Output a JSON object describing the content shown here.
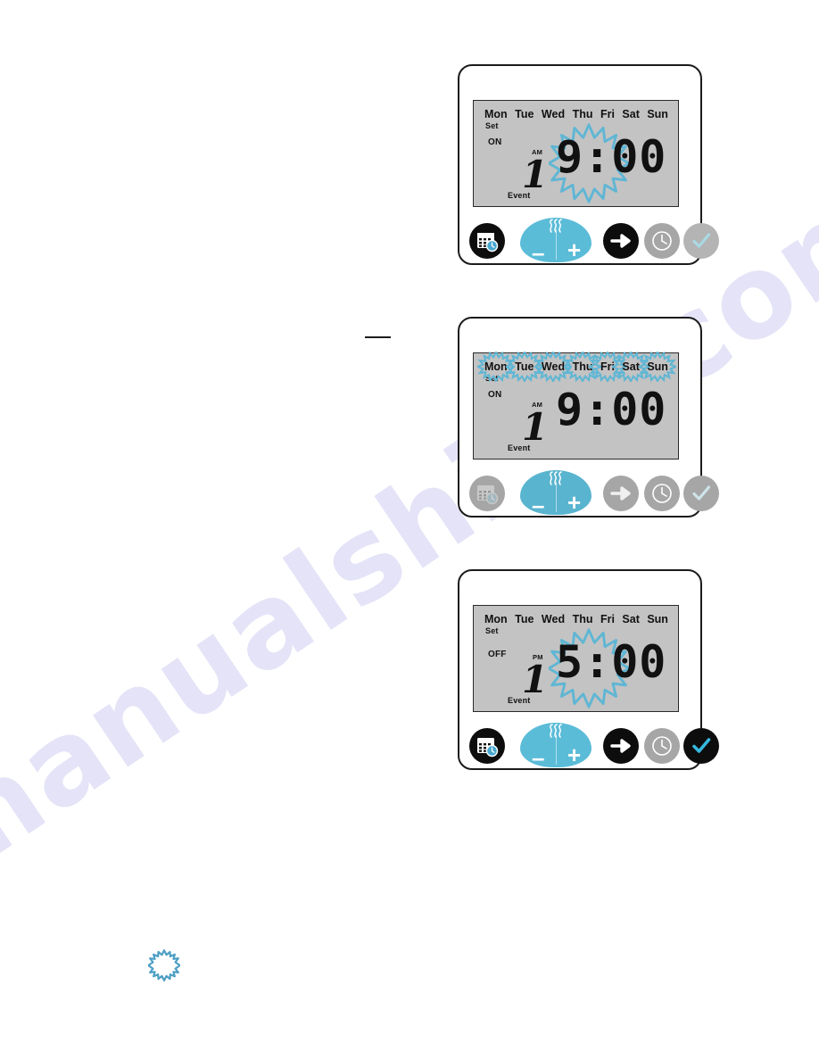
{
  "page": {
    "watermark": "manualshive.com",
    "background": "#ffffff"
  },
  "colors": {
    "accent_blue": "#5bbcd8",
    "burst_blue": "#5fb6d4",
    "lcd_grey": "#c3c3c3",
    "button_dark": "#0d0d0d",
    "button_grey": "#a6a6a6",
    "check_cyan": "#35b9de",
    "check_muted": "#a9d9e4"
  },
  "days": [
    "Mon",
    "Tue",
    "Wed",
    "Thu",
    "Fri",
    "Sat",
    "Sun"
  ],
  "devices": [
    {
      "id": "device-step-1",
      "display": {
        "days": [
          "Mon",
          "Tue",
          "Wed",
          "Thu",
          "Fri",
          "Sat",
          "Sun"
        ],
        "days_highlighted": [],
        "set_label": "Set",
        "state_label": "ON",
        "meridiem": "AM",
        "event_number": "1",
        "event_label": "Event",
        "time": "9:00",
        "time_highlighted": true
      },
      "buttons": [
        {
          "name": "calendar-clock-button",
          "icon": "calendar-clock-icon",
          "state": "active"
        },
        {
          "name": "minus-button",
          "icon": "minus-icon",
          "label": "–",
          "state": "active"
        },
        {
          "name": "plus-button",
          "icon": "plus-icon",
          "label": "+",
          "state": "active"
        },
        {
          "name": "steam-icon",
          "icon": "steam-icon",
          "state": "active"
        },
        {
          "name": "next-arrow-button",
          "icon": "arrow-right-icon",
          "state": "active"
        },
        {
          "name": "clock-button",
          "icon": "clock-icon",
          "state": "inactive"
        },
        {
          "name": "confirm-button",
          "icon": "checkmark-icon",
          "state": "inactive"
        }
      ]
    },
    {
      "id": "device-step-2",
      "display": {
        "days": [
          "Mon",
          "Tue",
          "Wed",
          "Thu",
          "Fri",
          "Sat",
          "Sun"
        ],
        "days_highlighted": [
          "Mon",
          "Tue",
          "Wed",
          "Thu",
          "Fri",
          "Sat",
          "Sun"
        ],
        "set_label": "Set",
        "state_label": "ON",
        "meridiem": "AM",
        "event_number": "1",
        "event_label": "Event",
        "time": "9:00",
        "time_highlighted": false
      },
      "buttons": [
        {
          "name": "calendar-clock-button",
          "icon": "calendar-clock-icon",
          "state": "inactive"
        },
        {
          "name": "minus-button",
          "icon": "minus-icon",
          "label": "–",
          "state": "active"
        },
        {
          "name": "plus-button",
          "icon": "plus-icon",
          "label": "+",
          "state": "active"
        },
        {
          "name": "steam-icon",
          "icon": "steam-icon",
          "state": "active"
        },
        {
          "name": "next-arrow-button",
          "icon": "arrow-right-icon",
          "state": "inactive"
        },
        {
          "name": "clock-button",
          "icon": "clock-icon",
          "state": "inactive"
        },
        {
          "name": "confirm-button",
          "icon": "checkmark-icon",
          "state": "inactive"
        }
      ]
    },
    {
      "id": "device-step-3",
      "display": {
        "days": [
          "Mon",
          "Tue",
          "Wed",
          "Thu",
          "Fri",
          "Sat",
          "Sun"
        ],
        "days_highlighted": [],
        "set_label": "Set",
        "state_label": "OFF",
        "meridiem": "PM",
        "event_number": "1",
        "event_label": "Event",
        "time": "5:00",
        "time_highlighted": true
      },
      "buttons": [
        {
          "name": "calendar-clock-button",
          "icon": "calendar-clock-icon",
          "state": "active"
        },
        {
          "name": "minus-button",
          "icon": "minus-icon",
          "label": "–",
          "state": "active"
        },
        {
          "name": "plus-button",
          "icon": "plus-icon",
          "label": "+",
          "state": "active"
        },
        {
          "name": "steam-icon",
          "icon": "steam-icon",
          "state": "active"
        },
        {
          "name": "next-arrow-button",
          "icon": "arrow-right-icon",
          "state": "active"
        },
        {
          "name": "clock-button",
          "icon": "clock-icon",
          "state": "inactive"
        },
        {
          "name": "confirm-button",
          "icon": "checkmark-icon",
          "state": "active"
        }
      ]
    }
  ],
  "legend": {
    "burst_icon": "starburst-blink-icon"
  },
  "d1": {
    "set": "Set",
    "state": "ON",
    "meridiem": "AM",
    "num": "1",
    "event": "Event",
    "time": "9:00"
  },
  "d2": {
    "set": "Set",
    "state": "ON",
    "meridiem": "AM",
    "num": "1",
    "event": "Event",
    "time": "9:00"
  },
  "d3": {
    "set": "Set",
    "state": "OFF",
    "meridiem": "PM",
    "num": "1",
    "event": "Event",
    "time": "5:00"
  }
}
